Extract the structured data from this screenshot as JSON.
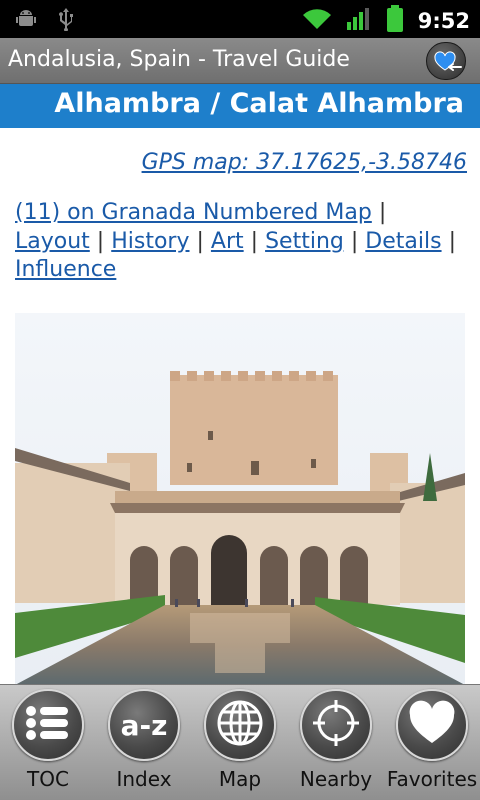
{
  "status_bar": {
    "time": "9:52",
    "icons": [
      "android-debug-icon",
      "usb-icon",
      "wifi-icon",
      "signal-icon",
      "battery-icon"
    ]
  },
  "title_bar": {
    "title": "Andalusia, Spain - Travel Guide",
    "favorite_icon": "heart-back-icon"
  },
  "page": {
    "title": "Alhambra / Calat Alhambra",
    "header_color": "#1e7fcb",
    "gps_link": "GPS map: 37.17625,-3.58746",
    "links": [
      {
        "label": "(11) on Granada Numbered Map"
      },
      {
        "label": "Layout"
      },
      {
        "label": "History"
      },
      {
        "label": "Art"
      },
      {
        "label": "Setting"
      },
      {
        "label": "Details"
      },
      {
        "label": "Influence"
      }
    ],
    "separator": "|",
    "link_color": "#1a5aa8"
  },
  "toolbar": {
    "items": [
      {
        "label": "TOC",
        "icon": "list-icon"
      },
      {
        "label": "Index",
        "icon": "a-z-icon",
        "glyph": "a-z"
      },
      {
        "label": "Map",
        "icon": "globe-icon"
      },
      {
        "label": "Nearby",
        "icon": "crosshair-icon"
      },
      {
        "label": "Favorites",
        "icon": "heart-icon"
      }
    ]
  }
}
